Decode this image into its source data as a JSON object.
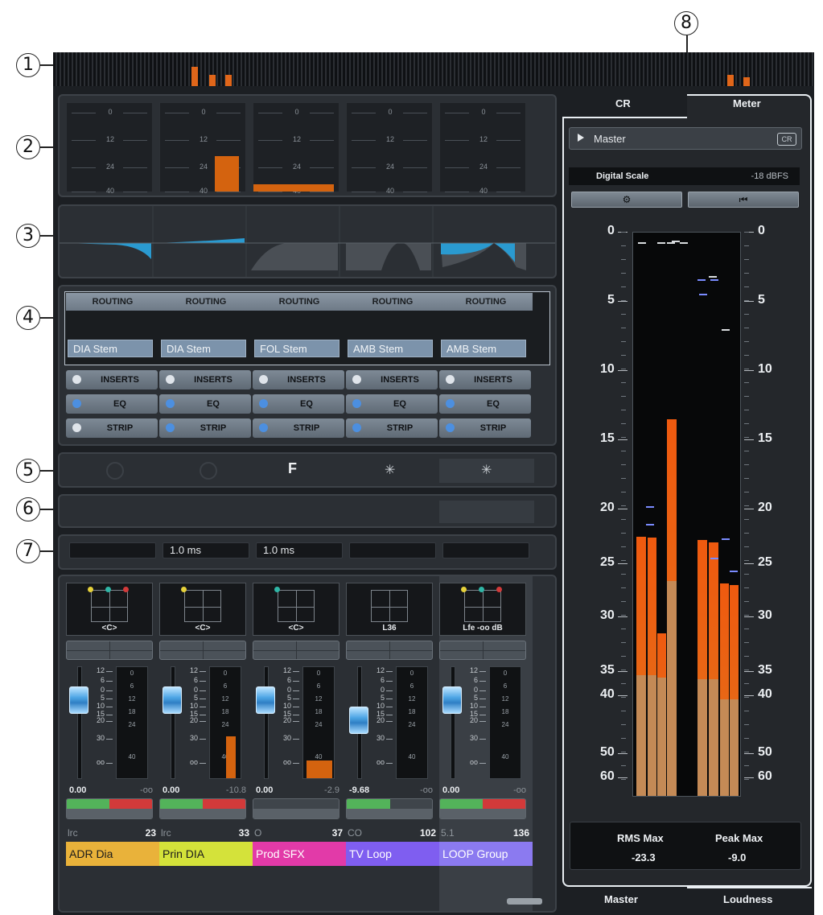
{
  "callouts": [
    "1",
    "2",
    "3",
    "4",
    "5",
    "6",
    "7",
    "8"
  ],
  "overview_level_pct": [
    0,
    0,
    0,
    0,
    0,
    0,
    0,
    52,
    27,
    27,
    0,
    0,
    0,
    0,
    0,
    0,
    0,
    0,
    0,
    0,
    0,
    0,
    0,
    0
  ],
  "section2": {
    "scale": [
      "0",
      "12",
      "24",
      "40"
    ],
    "channel_levels_pct": [
      0,
      40,
      8,
      0,
      0
    ]
  },
  "routing": {
    "header": "ROUTING",
    "outputs": [
      "DIA Stem",
      "DIA Stem",
      "FOL Stem",
      "AMB Stem",
      "AMB Stem"
    ]
  },
  "toggles": {
    "inserts": "INSERTS",
    "eq": "EQ",
    "strip": "STRIP"
  },
  "latency": [
    "",
    "1.0 ms",
    "1.0 ms",
    "",
    ""
  ],
  "fader_scale": [
    "12",
    "6",
    "0",
    "5",
    "10",
    "15",
    "20",
    "30",
    "oo"
  ],
  "meter_scale": [
    "0",
    "6",
    "12",
    "18",
    "24",
    "40"
  ],
  "channels": [
    {
      "pan": "<C>",
      "volume": "0.00",
      "peak": "-oo",
      "type": "lrc",
      "number": "23",
      "name": "ADR Dia",
      "color": "#e9b23a",
      "meter_pct": 0,
      "fader_pct": 70
    },
    {
      "pan": "<C>",
      "volume": "0.00",
      "peak": "-10.8",
      "type": "lrc",
      "number": "33",
      "name": "Prin DIA",
      "color": "#d4e23a",
      "meter_pct": 38,
      "fader_pct": 70
    },
    {
      "pan": "<C>",
      "volume": "0.00",
      "peak": "-2.9",
      "type": "O",
      "number": "37",
      "name": "Prod SFX",
      "color": "#e23aa8",
      "meter_pct": 16,
      "fader_pct": 70
    },
    {
      "pan": "L36",
      "volume": "-9.68",
      "peak": "-oo",
      "type": "CO",
      "number": "102",
      "name": "TV Loop",
      "color": "#7f5ef0",
      "meter_pct": 0,
      "fader_pct": 52
    },
    {
      "pan": "Lfe -oo dB",
      "volume": "0.00",
      "peak": "-oo",
      "type": "5.1",
      "number": "136",
      "name": "LOOP Group",
      "color": "#8b7af0",
      "meter_pct": 0,
      "fader_pct": 70
    }
  ],
  "right": {
    "tab_cr": "CR",
    "tab_meter": "Meter",
    "master": "Master",
    "cr_badge": "CR",
    "digital_scale": "Digital Scale",
    "dbfs": "-18 dBFS",
    "settings_icon": "gear-icon",
    "reset_icon": "skip-back-icon",
    "scale": [
      "0",
      "5",
      "10",
      "15",
      "20",
      "25",
      "30",
      "35",
      "40",
      "50",
      "60"
    ],
    "rms_label": "RMS Max",
    "peak_label": "Peak Max",
    "rms_value": "-23.3",
    "peak_value": "-9.0",
    "tab_master": "Master",
    "tab_loudness": "Loudness",
    "bar_tops_db": [
      22.5,
      22.6,
      31.5,
      13.5,
      22.8,
      23.0,
      26.8,
      27.0
    ],
    "bar_rms_db": [
      35.7,
      35.7,
      36.2,
      26.6,
      36.5,
      36.5,
      40.5,
      40.5
    ]
  }
}
